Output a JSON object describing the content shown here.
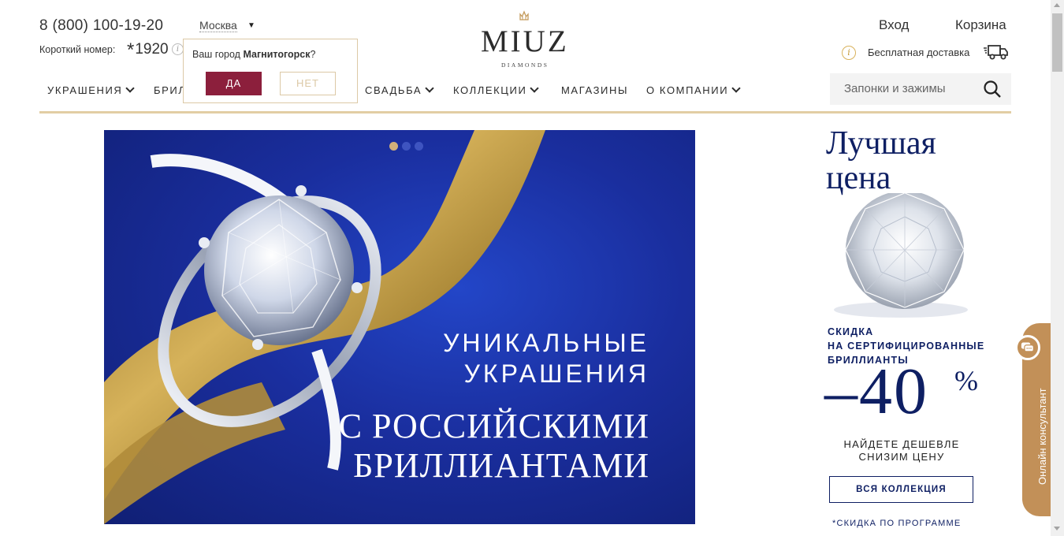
{
  "header": {
    "phone": "8 (800) 100-19-20",
    "city": "Москва",
    "short_label": "Короткий номер:",
    "short_star": "*",
    "short_number": "1920",
    "short_info_icon": "i",
    "login": "Вход",
    "cart": "Корзина",
    "delivery_info_icon": "i",
    "delivery_text": "Бесплатная доставка"
  },
  "city_popup": {
    "question_prefix": "Ваш город ",
    "question_city": "Магнитогорск",
    "question_suffix": "?",
    "yes": "ДА",
    "no": "НЕТ"
  },
  "logo": {
    "title": "MIUZ",
    "subtitle": "DIAMONDS"
  },
  "nav": {
    "items": [
      {
        "label": "УКРАШЕНИЯ",
        "has_dropdown": true
      },
      {
        "label": "БРИЛ",
        "has_dropdown": false
      },
      {
        "label": "СВАДЬБА",
        "has_dropdown": true
      },
      {
        "label": "КОЛЛЕКЦИИ",
        "has_dropdown": true
      },
      {
        "label": "МАГАЗИНЫ",
        "has_dropdown": false
      },
      {
        "label": "О КОМПАНИИ",
        "has_dropdown": true
      }
    ]
  },
  "search": {
    "placeholder": "Запонки и зажимы",
    "icon": "search-icon"
  },
  "banner": {
    "line1": "УНИКАЛЬНЫЕ",
    "line2": "УКРАШЕНИЯ",
    "line3": "С РОССИЙСКИМИ",
    "line4": "БРИЛЛИАНТАМИ",
    "slides": 3,
    "active_slide": 1
  },
  "promo": {
    "title_line1": "Лучшая",
    "title_line2": "цена",
    "sub_line1": "СКИДКА",
    "sub_line2": "НА СЕРТИФИЦИРОВАННЫЕ",
    "sub_line3": "БРИЛЛИАНТЫ",
    "percent": "–40",
    "percent_sign": "%",
    "cheaper_line1": "НАЙДЕТЕ ДЕШЕВЛЕ",
    "cheaper_line2": "СНИЗИМ ЦЕНУ",
    "button": "ВСЯ КОЛЛЕКЦИЯ",
    "footnote": "*СКИДКА ПО ПРОГРАММЕ"
  },
  "consultant": {
    "label": "Онлайн консультант"
  },
  "colors": {
    "accent_burgundy": "#8c1f3c",
    "gold": "#e2cea4",
    "navy": "#0e1f63",
    "consultant_tab": "#c29058"
  }
}
